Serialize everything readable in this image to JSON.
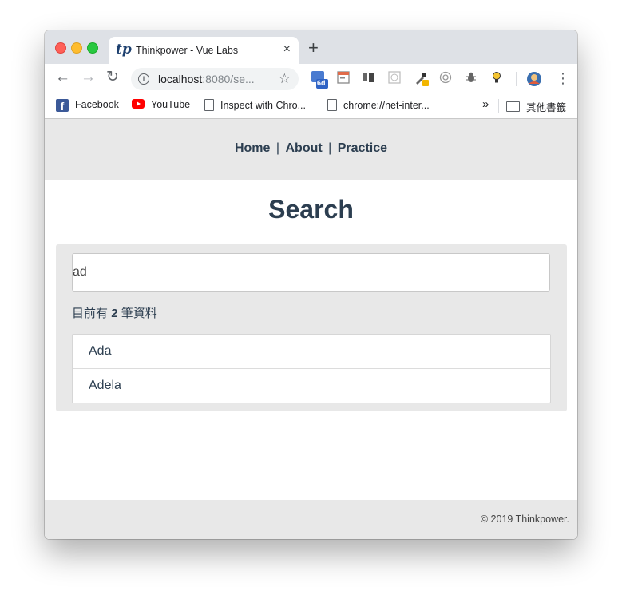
{
  "browser": {
    "tab": {
      "favicon": "tp",
      "title": "Thinkpower - Vue Labs",
      "close": "×"
    },
    "new_tab": "+",
    "toolbar": {
      "back": "←",
      "forward": "→",
      "reload": "↻",
      "url_host": "localhost",
      "url_rest": ":8080/se...",
      "star": "☆",
      "extension_badge": "6d",
      "menu": "⋮"
    },
    "bookmarks": [
      {
        "label": "Facebook",
        "icon": "facebook-icon"
      },
      {
        "label": "YouTube",
        "icon": "youtube-icon"
      },
      {
        "label": "Inspect with Chro...",
        "icon": "page-icon"
      },
      {
        "label": "chrome://net-inter...",
        "icon": "page-icon"
      }
    ],
    "bookmarks_overflow": "»",
    "other_bookmarks": "其他書籤"
  },
  "site": {
    "nav": {
      "home": "Home",
      "about": "About",
      "practice": "Practice",
      "separator": "|"
    },
    "title": "Search",
    "search": {
      "value": "ad"
    },
    "count": {
      "prefix": "目前有",
      "number": "2",
      "suffix": "筆資料"
    },
    "results": [
      "Ada",
      "Adela"
    ],
    "footer": "© 2019 Thinkpower."
  },
  "colors": {
    "text": "#2c3e50",
    "panel": "#e8e8e8",
    "tab_strip": "#dee1e6"
  }
}
